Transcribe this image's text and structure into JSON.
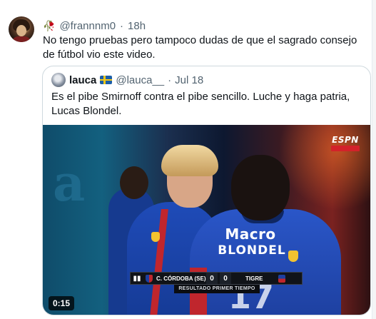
{
  "tweet": {
    "flower_icon": "wilted-flower-icon",
    "handle": "@frannnm0",
    "separator": "·",
    "time": "18h",
    "text": "No tengo pruebas pero tampoco dudas de que el sagrado consejo de fútbol vio este video."
  },
  "quote": {
    "name": "lauca",
    "flag_icon": "sweden-flag-icon",
    "handle": "@lauca__",
    "separator": "·",
    "date": "Jul 18",
    "text": "Es el pibe Smirnoff contra el pibe sencillo. Luche y haga patria, Lucas Blondel."
  },
  "video": {
    "background_text": "a",
    "broadcaster": "ESPN",
    "sponsor": "Macro",
    "player_name": "BLONDEL",
    "jersey_number": "17",
    "scoreboard": {
      "home_team": "C. CÓRDOBA (SE)",
      "home_score": "0",
      "away_score": "0",
      "away_team": "TIGRE",
      "period": "RESULTADO PRIMER TIEMPO"
    },
    "duration": "0:15"
  }
}
